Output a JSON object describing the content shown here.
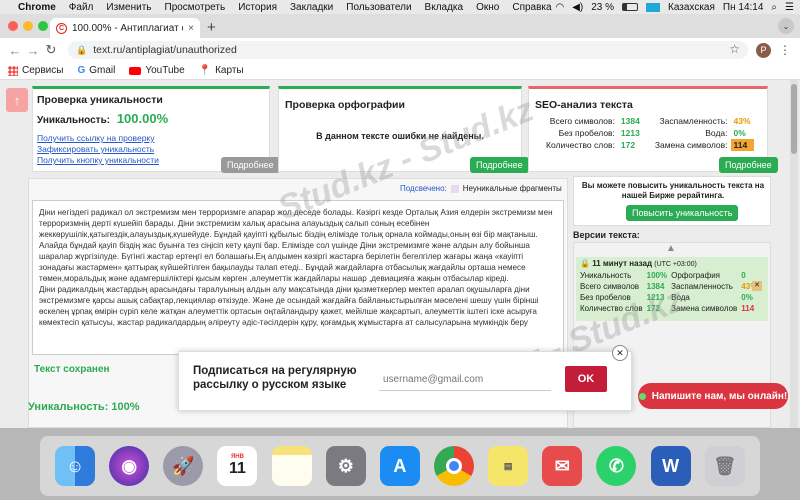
{
  "menubar": {
    "app": "Chrome",
    "items": [
      "Файл",
      "Изменить",
      "Просмотреть",
      "История",
      "Закладки",
      "Пользователи",
      "Вкладка",
      "Окно",
      "Справка"
    ],
    "battery": "23 %",
    "keyboard": "Казахская",
    "clock": "Пн 14:14"
  },
  "tab": {
    "title": "100.00% - Антиплагиат онлай",
    "close": "×",
    "new": "+"
  },
  "toolbar": {
    "url": "text.ru/antiplagiat/unauthorized",
    "profile": "P"
  },
  "bookmarks": [
    {
      "label": "Сервисы",
      "icon": "apps-grid-icon"
    },
    {
      "label": "Gmail",
      "icon": "google-icon"
    },
    {
      "label": "YouTube",
      "icon": "youtube-icon"
    },
    {
      "label": "Карты",
      "icon": "maps-pin-icon"
    }
  ],
  "uniqueness_panel": {
    "title": "Проверка уникальности",
    "label": "Уникальность:",
    "value": "100.00%",
    "links": [
      "Получить ссылку на проверку",
      "Зафиксировать уникальность",
      "Получить кнопку уникальности"
    ],
    "button": "Подробнее"
  },
  "spelling_panel": {
    "title": "Проверка орфографии",
    "message": "В данном тексте ошибки не найдены.",
    "button": "Подробнее"
  },
  "seo_panel": {
    "title": "SEO-анализ текста",
    "rows": [
      {
        "l1": "Всего символов:",
        "v1": "1384",
        "l2": "Заспамленность:",
        "v2": "43%"
      },
      {
        "l1": "Без пробелов:",
        "v1": "1213",
        "l2": "Вода:",
        "v2": "0%"
      },
      {
        "l1": "Количество слов:",
        "v1": "172",
        "l2": "Замена символов:",
        "v2": "114"
      }
    ],
    "button": "Подробнее"
  },
  "legend": {
    "label": "Подсвечено:",
    "item": "Неуникальные фрагменты"
  },
  "text_content": "Діни негіздегі радикал ол экстремизм мен терроризмге апарар жол деседе болады. Кәзіргі кезде Орталық Азия елдерін экстремизм мен терроризмнің дерті күшейіп барады. Діни экстремизм халық арасына алауыздық салып соның есебінен жеккөрушілік,қатыгездік,алауыздық,күшейуде. Бұндай қауіпті құбылыс біздің елімізде толық орнала коймады,оның өзі бір мақтаныш. Алайда бұндай қауіп біздің жас буынға тез сіңісіп кету қаупі бар. Елімізде сол үшінде Діни экстремизмге және алдын алу бойынша шаралар жүргізілуде. Бүгінгі жастар ертеңгі ел болашағы.Ең алдымен кәзіргі жастарға берілетін бегелгілер жағары жаңа «кауіпті зонадағы жастармен» қаттырақ күйшейтілген бақылауды талап етеді.. Бұндай жағдайларға отбасылық жағдайлы орташа немесе төмен,моральдық және адамгершіліктері қысым көрген ,алеуметтік жағдайлары нашар ,девиацияға жақын отбасылар кіреді.\nДіни радикалдың жастардың арасындағы таралуының алдын алу мақсатында діни қызметкерлер мектеп аралап оқушыларға діни экстремизмге қарсы ашық сабақтар,лекциялар өткізуде. Және де осындай жағдайға байланыстырылған мәселені шешу үшін бірінші өскелең ұрпақ өмірін сүріп келе жатқан алеуметтік ортасын оңтайландыру қажет, мейілше жақсартып, алеуметтік іштегі іске асыруға көмектесіп қатысуы, жастар радикалдардың әліреуту әдіс-тәсілдерін құру, қоғамдық жұмыстарға ат салысуларына мүмкіндік беру",
  "saved": "Текст сохранен",
  "bottom_uniqueness": "Уникальность: 100%",
  "raise_panel": {
    "text": "Вы можете повысить уникальность текста на нашей Бирже рерайтинга.",
    "button": "Повысить уникальность"
  },
  "versions": {
    "title": "Версии текста:",
    "time": "11 минут назад",
    "tz": "(UTC +03:00)",
    "rows": [
      {
        "l1": "Уникальность",
        "v1": "100%",
        "l2": "Орфография",
        "v2": "0"
      },
      {
        "l1": "Всего символов",
        "v1": "1384",
        "l2": "Заспамленность",
        "v2": "43%"
      },
      {
        "l1": "Без пробелов",
        "v1": "1213",
        "l2": "Вода",
        "v2": "0%"
      },
      {
        "l1": "Количество слов",
        "v1": "172",
        "l2": "Замена символов",
        "v2": "114"
      }
    ]
  },
  "popup": {
    "title": "Подписаться на регулярную рассылку о русском языке",
    "placeholder": "username@gmail.com",
    "button": "OK",
    "close": "✕"
  },
  "chat": {
    "label": "Напишите нам, мы онлайн!"
  },
  "watermark": "Stud.kz - Stud.kz",
  "dock": [
    {
      "name": "finder-icon",
      "color": "#3b8ee8"
    },
    {
      "name": "siri-icon",
      "color": "#5a3fd1"
    },
    {
      "name": "launchpad-icon",
      "color": "#9a9aa8"
    },
    {
      "name": "calendar-icon",
      "color": "#ffffff",
      "label": "11"
    },
    {
      "name": "notes-icon",
      "color": "#f7e27a"
    },
    {
      "name": "system-preferences-icon",
      "color": "#7a7a80"
    },
    {
      "name": "app-store-icon",
      "color": "#1b8cf2"
    },
    {
      "name": "chrome-icon",
      "color": "#ffffff"
    },
    {
      "name": "stickies-icon",
      "color": "#f5e66a"
    },
    {
      "name": "mail-icon",
      "color": "#e74b4b"
    },
    {
      "name": "whatsapp-icon",
      "color": "#2bd26b"
    },
    {
      "name": "word-icon",
      "color": "#2b5eb8",
      "label": "W"
    },
    {
      "name": "trash-icon",
      "color": "#d0d0d4"
    }
  ],
  "colors": {
    "green": "#2bab53",
    "red": "#d9343f",
    "orange": "#e69a00"
  }
}
